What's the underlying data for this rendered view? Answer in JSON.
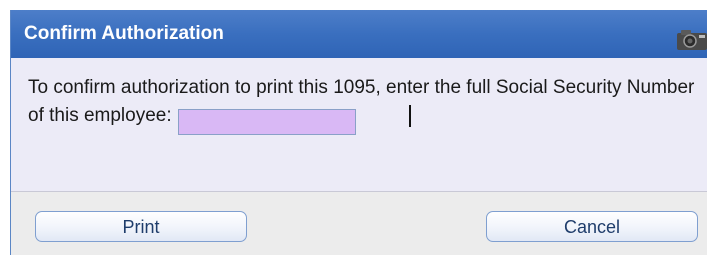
{
  "dialog": {
    "title": "Confirm Authorization",
    "message": "To confirm authorization to print this 1095, enter the full Social Security Number of this employee:",
    "ssn_input": {
      "value": "",
      "placeholder": ""
    },
    "buttons": {
      "print_label": "Print",
      "cancel_label": "Cancel"
    },
    "icons": {
      "titlebar": "camera-icon"
    },
    "colors": {
      "titlebar": "#3a6fbf",
      "input_background": "#d9b8f5",
      "body_background": "#ecebf7",
      "footer_background": "#ececec"
    }
  }
}
